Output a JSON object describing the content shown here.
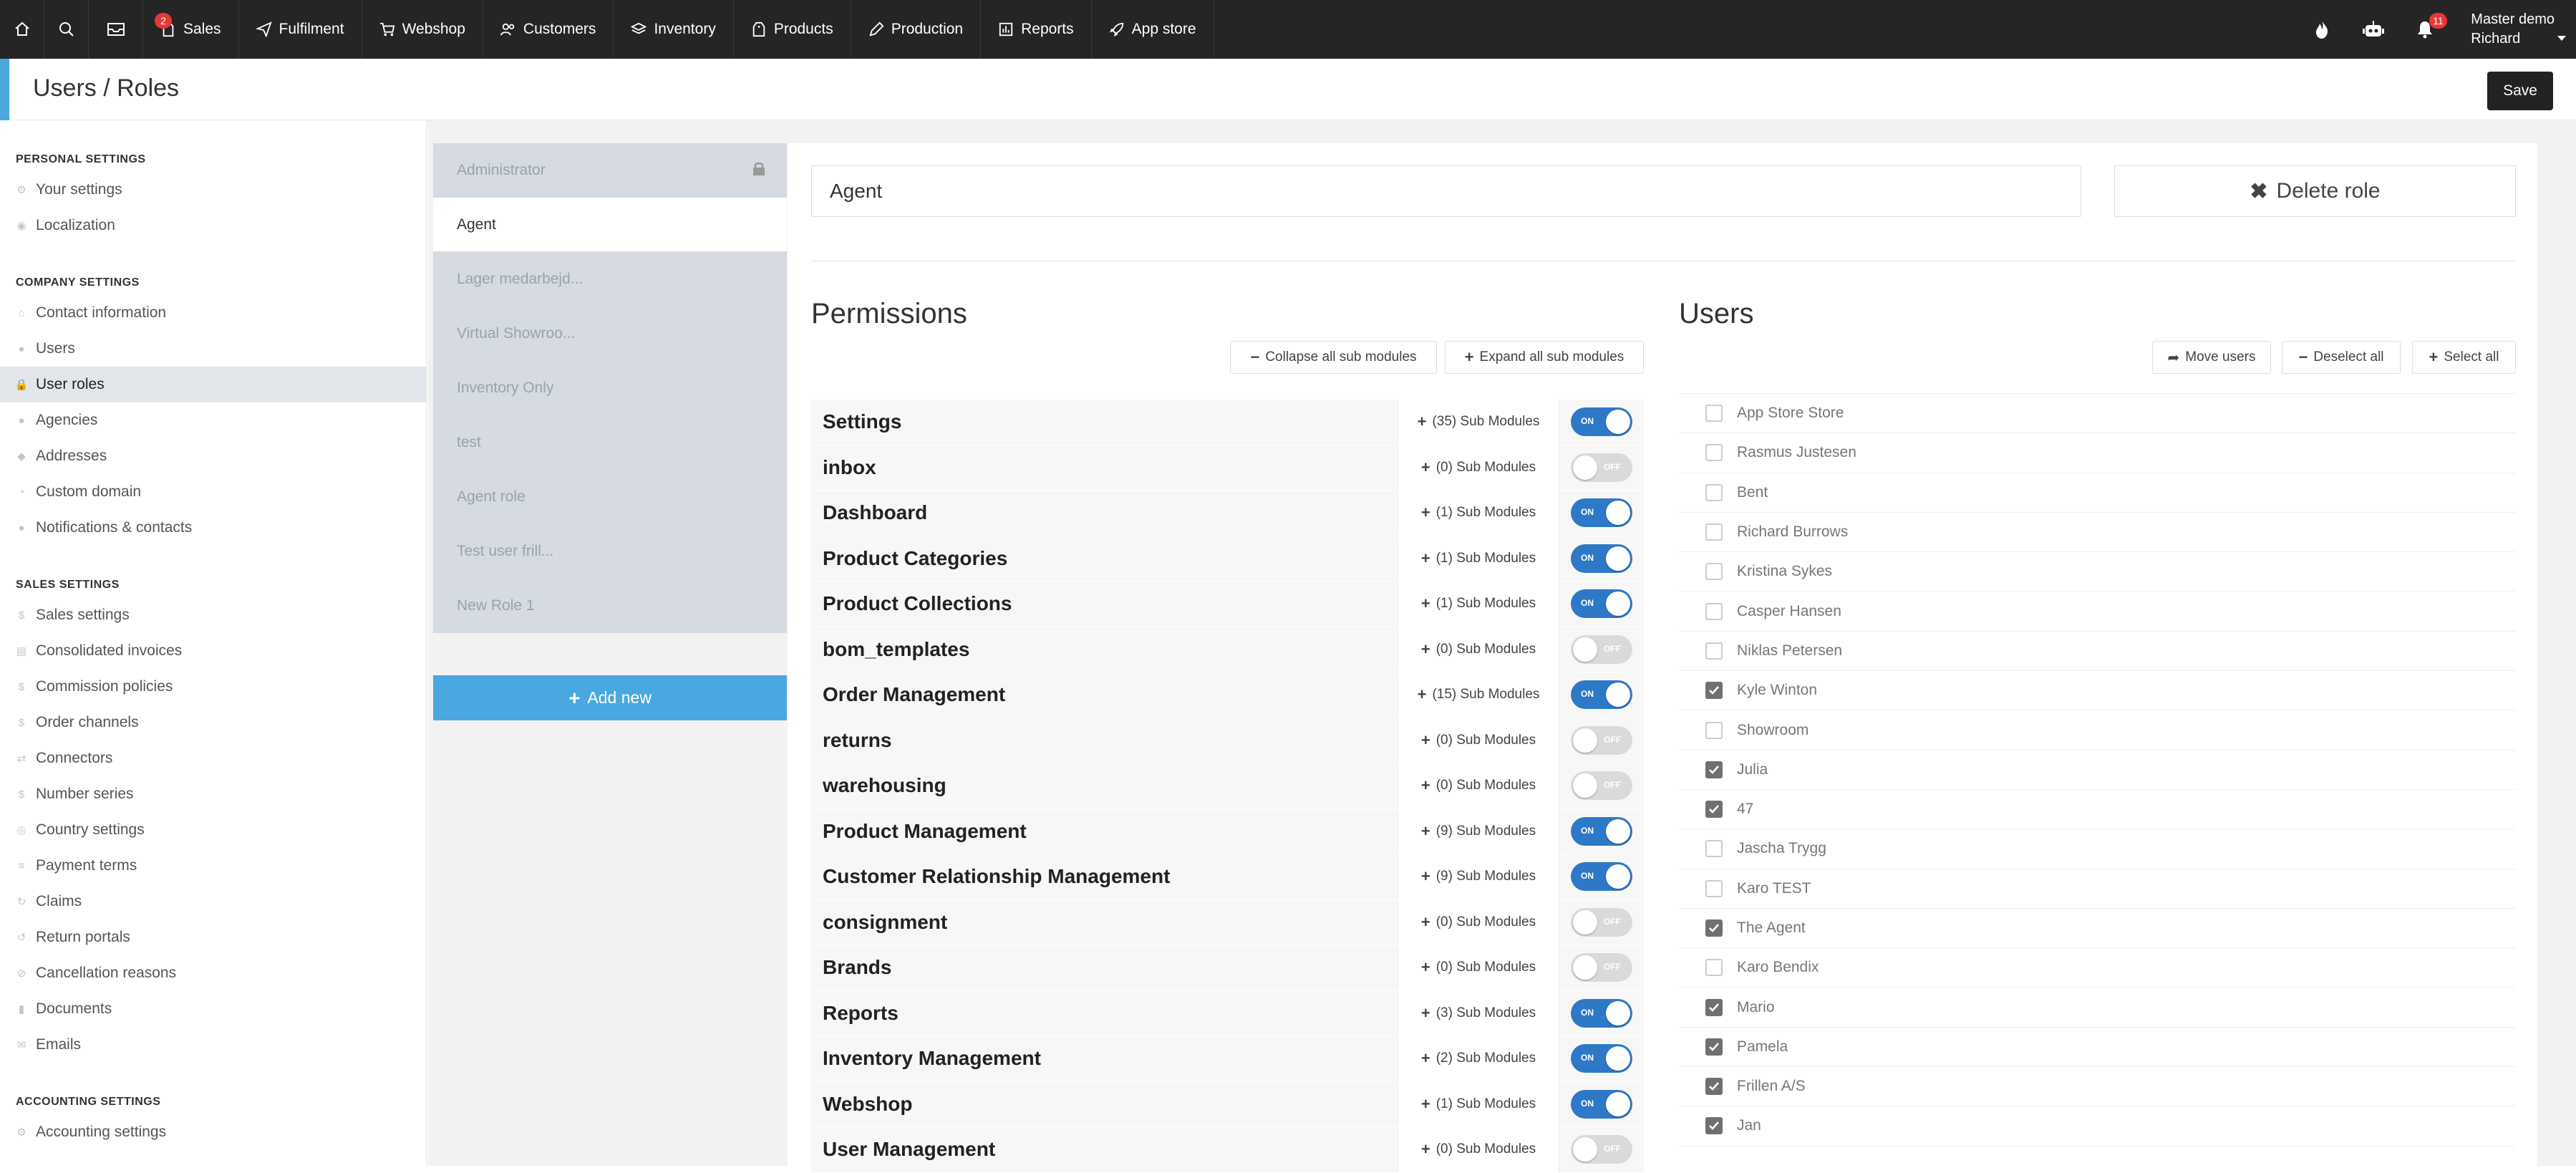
{
  "topnav": {
    "inbox_badge": "2",
    "items": [
      {
        "label": "Sales",
        "icon": "document-icon"
      },
      {
        "label": "Fulfilment",
        "icon": "paper-plane-icon"
      },
      {
        "label": "Webshop",
        "icon": "cart-icon"
      },
      {
        "label": "Customers",
        "icon": "users-icon"
      },
      {
        "label": "Inventory",
        "icon": "layers-icon"
      },
      {
        "label": "Products",
        "icon": "tag-icon"
      },
      {
        "label": "Production",
        "icon": "pencil-icon"
      },
      {
        "label": "Reports",
        "icon": "chart-icon"
      },
      {
        "label": "App store",
        "icon": "rocket-icon"
      }
    ],
    "notif_badge": "11",
    "user_line1": "Master demo",
    "user_line2": "Richard"
  },
  "page": {
    "title": "Users / Roles",
    "save_label": "Save"
  },
  "sidebar": {
    "personal_title": "PERSONAL SETTINGS",
    "personal": [
      "Your settings",
      "Localization"
    ],
    "company_title": "COMPANY SETTINGS",
    "company": [
      "Contact information",
      "Users",
      "User roles",
      "Agencies",
      "Addresses",
      "Custom domain",
      "Notifications & contacts"
    ],
    "sales_title": "SALES SETTINGS",
    "sales": [
      "Sales settings",
      "Consolidated invoices",
      "Commission policies",
      "Order channels",
      "Connectors",
      "Number series",
      "Country settings",
      "Payment terms",
      "Claims",
      "Return portals",
      "Cancellation reasons",
      "Documents",
      "Emails"
    ],
    "accounting_title": "ACCOUNTING SETTINGS",
    "accounting": [
      "Accounting settings"
    ]
  },
  "roles": [
    "Administrator",
    "Agent",
    "Lager medarbejd...",
    "Virtual Showroo...",
    "Inventory Only",
    "test",
    "Agent role",
    "Test user frill...",
    "New Role 1"
  ],
  "add_new_label": "Add new",
  "role_detail": {
    "name_value": "Agent",
    "delete_label": "Delete role",
    "permissions_title": "Permissions",
    "collapse_label": "Collapse all sub modules",
    "expand_label": "Expand all sub modules",
    "users_title": "Users",
    "move_users_label": "Move users",
    "deselect_all_label": "Deselect all",
    "select_all_label": "Select all"
  },
  "permissions": [
    {
      "name": "Settings",
      "sub": "(35) Sub Modules",
      "on": true
    },
    {
      "name": "inbox",
      "sub": "(0) Sub Modules",
      "on": false
    },
    {
      "name": "Dashboard",
      "sub": "(1) Sub Modules",
      "on": true
    },
    {
      "name": "Product Categories",
      "sub": "(1) Sub Modules",
      "on": true
    },
    {
      "name": "Product Collections",
      "sub": "(1) Sub Modules",
      "on": true
    },
    {
      "name": "bom_templates",
      "sub": "(0) Sub Modules",
      "on": false
    },
    {
      "name": "Order Management",
      "sub": "(15) Sub Modules",
      "on": true
    },
    {
      "name": "returns",
      "sub": "(0) Sub Modules",
      "on": false
    },
    {
      "name": "warehousing",
      "sub": "(0) Sub Modules",
      "on": false
    },
    {
      "name": "Product Management",
      "sub": "(9) Sub Modules",
      "on": true
    },
    {
      "name": "Customer Relationship Management",
      "sub": "(9) Sub Modules",
      "on": true
    },
    {
      "name": "consignment",
      "sub": "(0) Sub Modules",
      "on": false
    },
    {
      "name": "Brands",
      "sub": "(0) Sub Modules",
      "on": false
    },
    {
      "name": "Reports",
      "sub": "(3) Sub Modules",
      "on": true
    },
    {
      "name": "Inventory Management",
      "sub": "(2) Sub Modules",
      "on": true
    },
    {
      "name": "Webshop",
      "sub": "(1) Sub Modules",
      "on": true
    },
    {
      "name": "User Management",
      "sub": "(0) Sub Modules",
      "on": false
    }
  ],
  "toggle_on_label": "ON",
  "toggle_off_label": "OFF",
  "users": [
    {
      "name": "App Store Store",
      "checked": false
    },
    {
      "name": "Rasmus Justesen",
      "checked": false
    },
    {
      "name": "Bent",
      "checked": false
    },
    {
      "name": "Richard Burrows",
      "checked": false
    },
    {
      "name": "Kristina Sykes",
      "checked": false
    },
    {
      "name": "Casper Hansen",
      "checked": false
    },
    {
      "name": "Niklas Petersen",
      "checked": false
    },
    {
      "name": "Kyle Winton",
      "checked": true
    },
    {
      "name": "Showroom",
      "checked": false
    },
    {
      "name": "Julia",
      "checked": true
    },
    {
      "name": "47",
      "checked": true
    },
    {
      "name": "Jascha Trygg",
      "checked": false
    },
    {
      "name": "Karo TEST",
      "checked": false
    },
    {
      "name": "The Agent",
      "checked": true
    },
    {
      "name": "Karo Bendix",
      "checked": false
    },
    {
      "name": "Mario",
      "checked": true
    },
    {
      "name": "Pamela",
      "checked": true
    },
    {
      "name": "Frillen A/S",
      "checked": true
    },
    {
      "name": "Jan",
      "checked": true
    }
  ]
}
